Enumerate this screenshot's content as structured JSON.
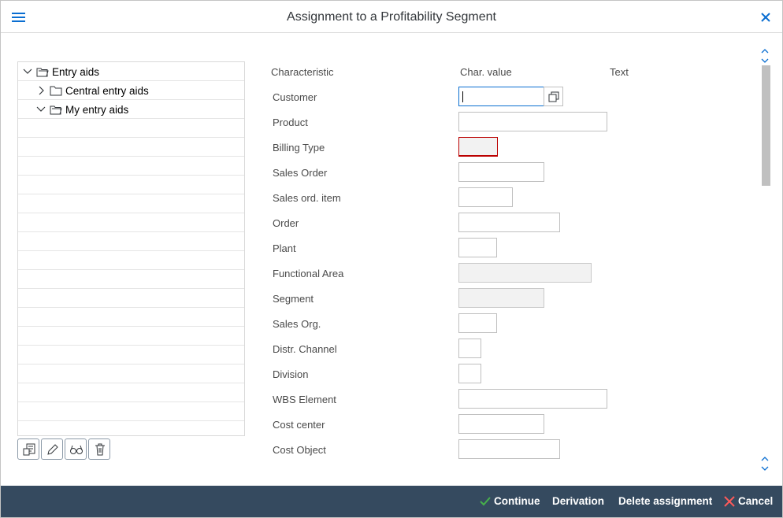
{
  "dialog": {
    "title": "Assignment to a Profitability Segment"
  },
  "tree": {
    "items": [
      {
        "label": "Entry aids",
        "expanded": true
      },
      {
        "label": "Central entry aids",
        "expanded": false
      },
      {
        "label": "My entry aids",
        "expanded": true
      }
    ],
    "toolbar": [
      "create-entry-aid-icon",
      "edit-icon",
      "display-glasses-icon",
      "delete-icon"
    ]
  },
  "columns": {
    "characteristic": "Characteristic",
    "char_value": "Char. value",
    "text": "Text"
  },
  "fields": [
    {
      "label": "Customer",
      "value": ""
    },
    {
      "label": "Product",
      "value": ""
    },
    {
      "label": "Billing Type",
      "value": ""
    },
    {
      "label": "Sales Order",
      "value": ""
    },
    {
      "label": "Sales ord. item",
      "value": ""
    },
    {
      "label": "Order",
      "value": ""
    },
    {
      "label": "Plant",
      "value": ""
    },
    {
      "label": "Functional Area",
      "value": ""
    },
    {
      "label": "Segment",
      "value": ""
    },
    {
      "label": "Sales Org.",
      "value": ""
    },
    {
      "label": "Distr. Channel",
      "value": ""
    },
    {
      "label": "Division",
      "value": ""
    },
    {
      "label": "WBS Element",
      "value": ""
    },
    {
      "label": "Cost center",
      "value": ""
    },
    {
      "label": "Cost Object",
      "value": ""
    }
  ],
  "footer": {
    "continue": "Continue",
    "derivation": "Derivation",
    "delete_assignment": "Delete assignment",
    "cancel": "Cancel"
  },
  "colors": {
    "accent": "#0a6ed1",
    "footer_bg": "#354a5f",
    "continue_icon": "#2b7d2b",
    "cancel_icon": "#bb0000",
    "error_border": "#bb0000"
  }
}
